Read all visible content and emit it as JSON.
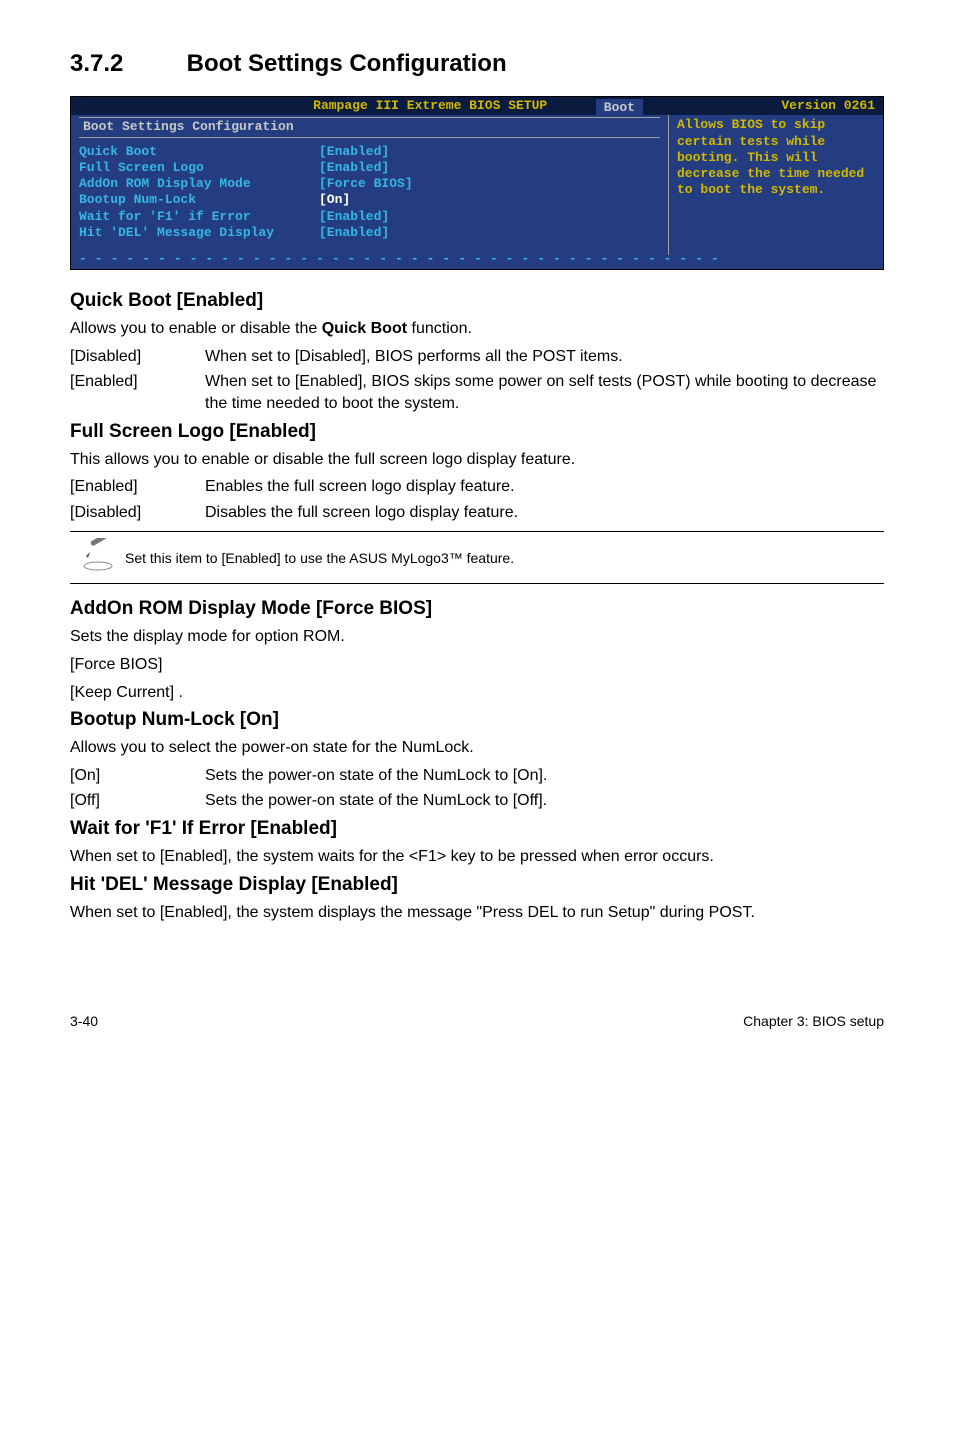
{
  "heading": {
    "number": "3.7.2",
    "title": "Boot Settings Configuration"
  },
  "bios": {
    "header_title": "Rampage III Extreme BIOS SETUP",
    "version": "Version 0261",
    "boot_tab": "Boot",
    "subhead": "Boot Settings Configuration",
    "items": [
      {
        "label": "Quick Boot",
        "value": "[Enabled]",
        "white": false
      },
      {
        "label": "Full Screen Logo",
        "value": "[Enabled]",
        "white": false
      },
      {
        "label": "AddOn ROM Display Mode",
        "value": "[Force BIOS]",
        "white": false
      },
      {
        "label": "Bootup Num-Lock",
        "value": "[On]",
        "white": true
      },
      {
        "label": "Wait for 'F1' if Error",
        "value": "[Enabled]",
        "white": false
      },
      {
        "label": "Hit 'DEL' Message Display",
        "value": "[Enabled]",
        "white": false
      }
    ],
    "help": "Allows BIOS to skip certain tests while booting. This will decrease the time needed to boot the system."
  },
  "sections": [
    {
      "heading": "Quick Boot [Enabled]",
      "intro_html": "Allows you to enable or disable the <b>Quick Boot</b> function.",
      "rows": [
        {
          "opt": "[Disabled]",
          "desc": "When set to [Disabled], BIOS performs all the POST items."
        },
        {
          "opt": "[Enabled]",
          "desc": "When set to [Enabled], BIOS skips some power on self tests (POST) while booting to decrease the time needed to boot the system."
        }
      ]
    },
    {
      "heading": "Full Screen Logo [Enabled]",
      "intro": "This allows you to enable or disable the full screen logo display feature.",
      "rows": [
        {
          "opt": "[Enabled]",
          "desc": "Enables the full screen logo display feature."
        },
        {
          "opt": "[Disabled]",
          "desc": "Disables the full screen logo display feature."
        }
      ],
      "note": "Set this item to [Enabled] to use the ASUS MyLogo3™ feature."
    },
    {
      "heading": "AddOn ROM Display Mode [Force BIOS]",
      "intro": "Sets the display mode for option ROM.",
      "lines": [
        "[Force BIOS]",
        "[Keep Current]  ."
      ]
    },
    {
      "heading": "Bootup Num-Lock [On]",
      "intro": "Allows you to select the power-on state for the NumLock.",
      "rows": [
        {
          "opt": "[On]",
          "desc": "Sets the power-on state of the NumLock to [On]."
        },
        {
          "opt": "[Off]",
          "desc": "Sets the power-on state of the NumLock to [Off]."
        }
      ]
    },
    {
      "heading": "Wait for 'F1' If Error [Enabled]",
      "intro": "When set to [Enabled], the system waits for the <F1> key to be pressed when error occurs."
    },
    {
      "heading": "Hit 'DEL' Message Display [Enabled]",
      "intro": "When set to [Enabled], the system displays the message \"Press DEL to run Setup\" during POST."
    }
  ],
  "footer": {
    "left": "3-40",
    "right": "Chapter 3: BIOS setup"
  }
}
